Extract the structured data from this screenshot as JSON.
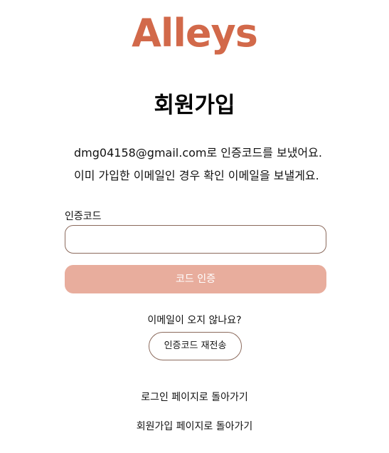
{
  "brand": {
    "logo_text": "Alleys",
    "accent_color": "#d2694a"
  },
  "page": {
    "title": "회원가입"
  },
  "message": {
    "line1": "dmg04158@gmail.com로 인증코드를 보냈어요.",
    "line2": "이미 가입한 이메일인 경우 확인 이메일을 보낼게요."
  },
  "code_field": {
    "label": "인증코드",
    "value": "",
    "placeholder": ""
  },
  "verify_button": {
    "label": "코드 인증",
    "color": "#e8ad9d"
  },
  "resend": {
    "prompt": "이메일이 오지 않나요?",
    "button_label": "인증코드 재전송"
  },
  "links": {
    "back_to_login": "로그인 페이지로 돌아가기",
    "back_to_signup": "회원가입 페이지로 돌아가기"
  }
}
